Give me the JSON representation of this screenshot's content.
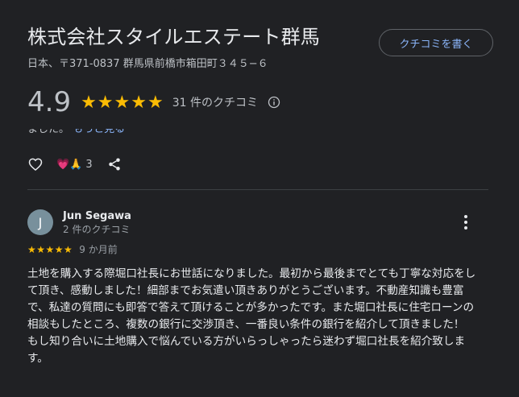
{
  "business": {
    "name": "株式会社スタイルエステート群馬",
    "address": "日本、〒371-0837 群馬県前橋市箱田町３４５−６",
    "write_review_label": "クチコミを書く"
  },
  "rating": {
    "value": "4.9",
    "stars": "★★★★★",
    "count_text": "31 件のクチコミ"
  },
  "previous_review": {
    "cut_text": "ました。",
    "more_label": "もっと見る",
    "reaction_emojis": "💗🙏",
    "reaction_count": "3"
  },
  "review": {
    "avatar_initial": "J",
    "author": "Jun Segawa",
    "author_sub": "2 件のクチコミ",
    "stars": "★★★★★",
    "time": "9 か月前",
    "text": "土地を購入する際堀口社長にお世話になりました。最初から最後までとても丁寧な対応をして頂き、感動しました！細部までお気遣い頂きありがとうございます。不動産知識も豊富で、私達の質問にも即答で答えて頂けることが多かったです。また堀口社長に住宅ローンの相談もしたところ、複数の銀行に交渉頂き、一番良い条件の銀行を紹介して頂きました！\nもし知り合いに土地購入で悩んでいる方がいらっしゃったら迷わず堀口社長を紹介致します。"
  },
  "colors": {
    "background": "#202124",
    "star": "#fbbc04",
    "link": "#8ab4f8",
    "avatar": "#78909c"
  },
  "icons": [
    "info-icon",
    "heart-icon",
    "share-icon",
    "more-vert-icon"
  ]
}
